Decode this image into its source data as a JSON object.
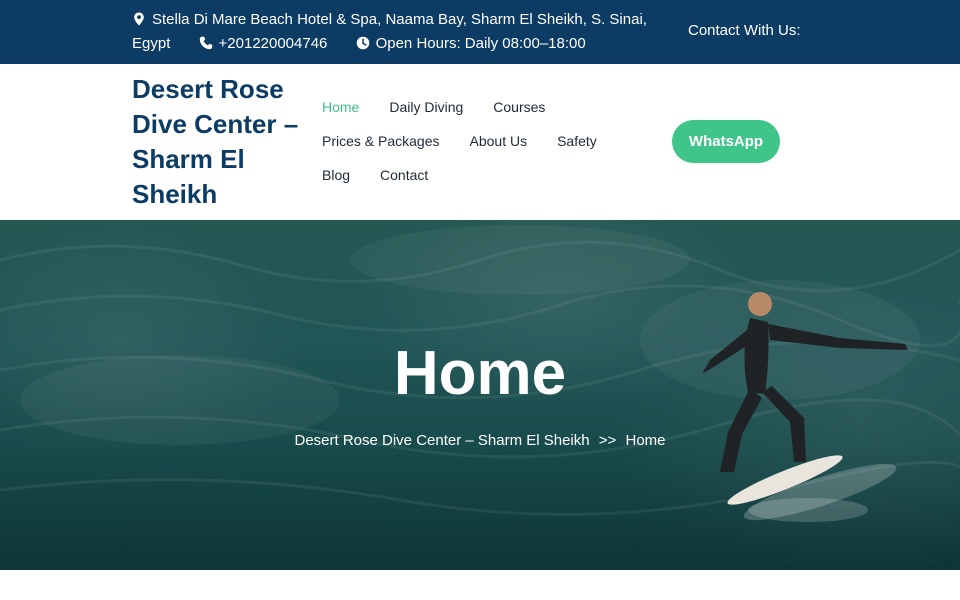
{
  "topbar": {
    "address": "Stella Di Mare Beach Hotel & Spa, Naama Bay, Sharm El Sheikh, S. Sinai, Egypt",
    "phone": "+201220004746",
    "hours": "Open Hours: Daily 08:00–18:00",
    "contact_label": "Contact With Us:",
    "icons": [
      "map-pin-icon",
      "phone-icon",
      "clock-icon"
    ]
  },
  "header": {
    "brand": "Desert Rose Dive Center – Sharm El Sheikh",
    "nav": [
      {
        "label": "Home",
        "active": true
      },
      {
        "label": "Daily Diving"
      },
      {
        "label": "Courses"
      },
      {
        "label": "Prices & Packages"
      },
      {
        "label": "About Us"
      },
      {
        "label": "Safety"
      },
      {
        "label": "Blog"
      },
      {
        "label": "Contact"
      }
    ],
    "cta_label": "WhatsApp"
  },
  "hero": {
    "title": "Home",
    "breadcrumb": {
      "root": "Desert Rose Dive Center – Sharm El Sheikh",
      "separator": ">>",
      "current": "Home"
    }
  },
  "colors": {
    "topbar_bg": "#0c3b63",
    "brand_text": "#0c3b63",
    "nav_active": "#3fbf86",
    "cta_bg": "#3fc58a",
    "hero_water": "#2b6c6a"
  }
}
